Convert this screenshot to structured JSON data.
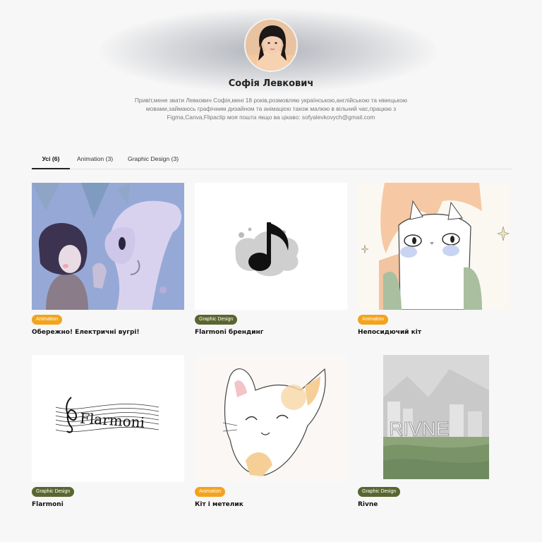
{
  "profile": {
    "name": "Софія Левкович",
    "bio": "Привіт,мене звати Левкович Софія,мені 18 років,розмовляю українською,англійською та німецькою мовами,займаюсь графічним дизайном та анімацією також малюю в вільний час,працюю з Figma,Canva,Flipaclip моя пошта якщо ва цікаво: sofyalevkovych@gmail.com"
  },
  "tabs": [
    {
      "label": "Усі (6)"
    },
    {
      "label": "Animation (3)"
    },
    {
      "label": "Graphic Design (3)"
    }
  ],
  "cards": [
    {
      "category": "Animation",
      "title": "Обережно! Електричні вугрі!"
    },
    {
      "category": "Graphic Design",
      "title": "Flarmoni брендинг"
    },
    {
      "category": "Animation",
      "title": "Непосидючий кіт"
    },
    {
      "category": "Graphic Design",
      "title": "Flarmoni"
    },
    {
      "category": "Animation",
      "title": "Кіт і метелик"
    },
    {
      "category": "Graphic Design",
      "title": "Rivne"
    }
  ],
  "artwork_text": {
    "flarmoni_logo": "Flarmoni",
    "rivne_sign": "RIVNE"
  },
  "colors": {
    "animation_badge": "#f3a31c",
    "graphic_design_badge": "#5a6630",
    "background": "#f7f7f7"
  }
}
